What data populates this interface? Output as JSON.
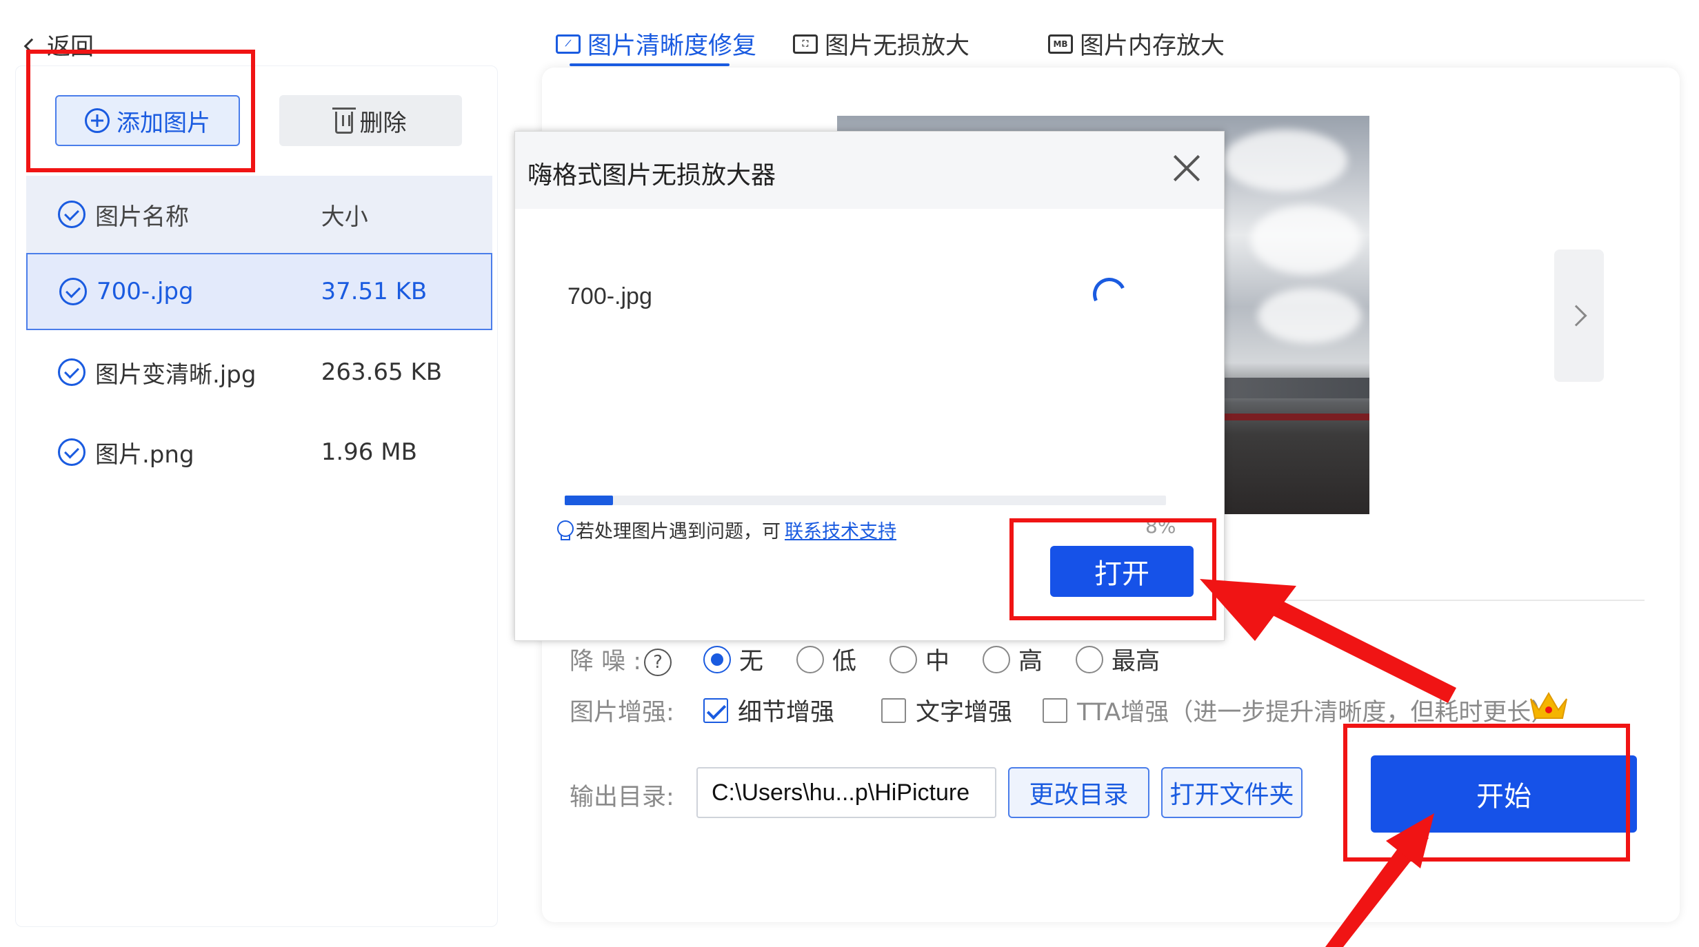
{
  "sidebar": {
    "back_label": "返回",
    "add_label": "添加图片",
    "delete_label": "删除",
    "table": {
      "headers": [
        "图片名称",
        "大小"
      ],
      "rows": [
        {
          "name": "700-.jpg",
          "size": "37.51 KB",
          "selected": true
        },
        {
          "name": "图片变清晰.jpg",
          "size": "263.65 KB",
          "selected": false
        },
        {
          "name": "图片.png",
          "size": "1.96 MB",
          "selected": false
        }
      ]
    }
  },
  "tabs": [
    {
      "label": "图片清晰度修复",
      "active": true,
      "icon": "image-repair-icon"
    },
    {
      "label": "图片无损放大",
      "active": false,
      "icon": "expand-icon"
    },
    {
      "label": "图片内存放大",
      "active": false,
      "icon": "mb-icon",
      "icon_text": "MB"
    }
  ],
  "dialog": {
    "title": "嗨格式图片无损放大器",
    "file_name": "700-.jpg",
    "progress_percent": 8,
    "progress_label": "8%",
    "tip_text": "若处理图片遇到问题，可",
    "tip_link": "联系技术支持",
    "open_label": "打开"
  },
  "options": {
    "denoise_label": "降 噪 :",
    "denoise_options": [
      {
        "label": "无",
        "selected": true
      },
      {
        "label": "低",
        "selected": false
      },
      {
        "label": "中",
        "selected": false
      },
      {
        "label": "高",
        "selected": false
      },
      {
        "label": "最高",
        "selected": false
      }
    ],
    "enhance_label": "图片增强:",
    "enhance_options": [
      {
        "label": "细节增强",
        "checked": true
      },
      {
        "label": "文字增强",
        "checked": false
      },
      {
        "label": "TTA增强（进一步提升清晰度，但耗时更长）",
        "checked": false
      }
    ],
    "output_label": "输出目录:",
    "output_path": "C:\\Users\\hu...p\\HiPicture",
    "change_dir_label": "更改目录",
    "open_folder_label": "打开文件夹",
    "start_label": "开始"
  },
  "colors": {
    "accent": "#1652e8",
    "annotation": "#f01414"
  }
}
